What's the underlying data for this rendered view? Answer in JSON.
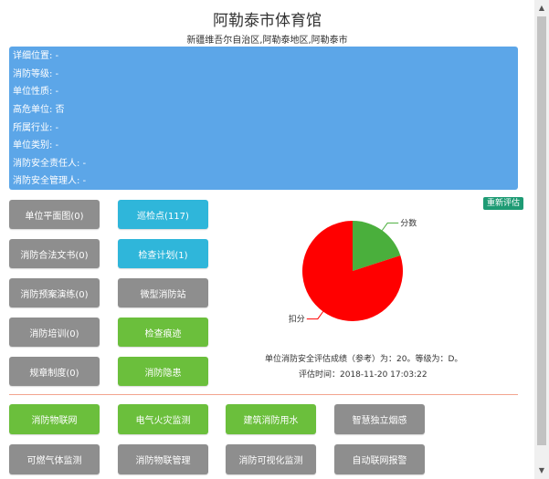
{
  "page": {
    "title": "阿勒泰市体育馆",
    "address": "新疆维吾尔自治区,阿勒泰地区,阿勒泰市"
  },
  "info": {
    "rows": [
      "详细位置: -",
      "消防等级: -",
      "单位性质: -",
      "高危单位: 否",
      "所属行业: -",
      "单位类别: -",
      "消防安全责任人: -",
      "消防安全管理人: -"
    ]
  },
  "buttons": {
    "floor_plan": "单位平面图(0)",
    "patrol_points": "巡检点(117)",
    "legal_docs": "消防合法文书(0)",
    "inspection_plan": "检查计划(1)",
    "drill": "消防预案演练(0)",
    "mini_station": "微型消防站",
    "training": "消防培训(0)",
    "inspection_trace": "检查痕迹",
    "rules": "规章制度(0)",
    "hazards": "消防隐患"
  },
  "colors": {
    "info_background": "#5ca6e8",
    "gray_button": "#8e8e8e",
    "cyan_button": "#2fb6da",
    "green_button": "#6bbf3c",
    "reevaluate_badge": "#1e9b74",
    "divider": "#f3a48f",
    "score_slice": "#4aaf3c",
    "deduction_slice": "#ff0000"
  },
  "evaluation": {
    "reevaluate_label": "重新评估",
    "summary": "单位消防安全评估成绩（参考）为：20。等级为：D。",
    "time": "评估时间：2018-11-20 17:03:22"
  },
  "chart_data": {
    "type": "pie",
    "slices": [
      {
        "label": "分数",
        "value": 20,
        "color": "#4aaf3c"
      },
      {
        "label": "扣分",
        "value": 80,
        "color": "#ff0000"
      }
    ]
  },
  "iot": {
    "fire_iot": "消防物联网",
    "electrical_fire": "电气火灾监测",
    "water_monitor": "建筑消防用水",
    "smoke_sensor": "智慧独立烟感",
    "gas_monitor": "可燃气体监测",
    "iot_management": "消防物联管理",
    "visual_monitor": "消防可视化监测",
    "auto_alarm": "自动联网报警"
  }
}
